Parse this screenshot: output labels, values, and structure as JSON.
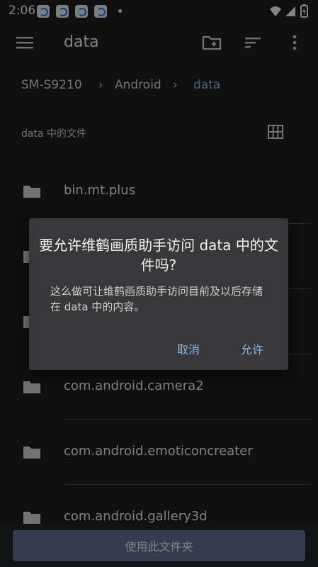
{
  "status_bar": {
    "time": "2:06",
    "notification_icons": [
      "app-notification-icon",
      "app-notification-icon",
      "app-notification-icon",
      "app-notification-icon"
    ],
    "system_icons": [
      "wifi-icon",
      "signal-icon",
      "battery-charging-icon"
    ]
  },
  "toolbar": {
    "title": "data",
    "icons": [
      "menu-icon",
      "new-folder-icon",
      "sort-icon",
      "more-vert-icon"
    ]
  },
  "breadcrumb": [
    "SM-S9210",
    "Android",
    "data"
  ],
  "section": {
    "label": "data 中的文件",
    "view_icon": "grid-view-icon"
  },
  "files": [
    {
      "name": "bin.mt.plus"
    },
    {
      "name": ""
    },
    {
      "name": ""
    },
    {
      "name": "com.android.camera2"
    },
    {
      "name": "com.android.emoticoncreater"
    },
    {
      "name": "com.android.gallery3d"
    }
  ],
  "dialog": {
    "title": "要允许维鹤画质助手访问 data 中的文件吗?",
    "message": "这么做可让维鹤画质助手访问目前及以后存储在 data 中的内容。",
    "cancel_label": "取消",
    "allow_label": "允许"
  },
  "bottom_button": {
    "label": "使用此文件夹"
  },
  "colors": {
    "background": "#1e1e20",
    "dialog": "#38383a",
    "accent": "#8fb3e6",
    "button": "#5d6f91"
  }
}
